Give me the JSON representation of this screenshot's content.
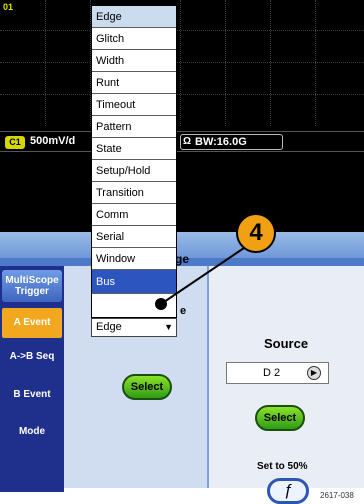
{
  "scope": {
    "channel_label": "01",
    "ch1_badge": "C1",
    "ch1_scale": "500mV/d",
    "omega": "Ω",
    "bw_value": "BW:16.0G"
  },
  "panel": {
    "title": "ge",
    "left_tabs": [
      "MultiScope\nTrigger",
      "A Event",
      "A->B Seq",
      "B Event",
      "Mode"
    ],
    "middle_select_label": "Select",
    "right_select_label": "Select",
    "type_partial_label": "e",
    "source": {
      "label": "Source",
      "value": "D 2"
    },
    "set50_label": "Set to 50%",
    "set50_icon": "rising-edge-icon"
  },
  "dropdown": {
    "options": [
      "Edge",
      "Glitch",
      "Width",
      "Runt",
      "Timeout",
      "Pattern",
      "State",
      "Setup/Hold",
      "Transition",
      "Comm",
      "Serial",
      "Window",
      "Bus"
    ],
    "highlighted": "Edge",
    "active": "Bus",
    "current_value": "Edge"
  },
  "callout": {
    "number": "4"
  },
  "figure_number": "2617-038",
  "colors": {
    "accent_orange": "#f2a81e",
    "panel_blue": "#4c79c8",
    "select_green": "#2f9c16"
  }
}
